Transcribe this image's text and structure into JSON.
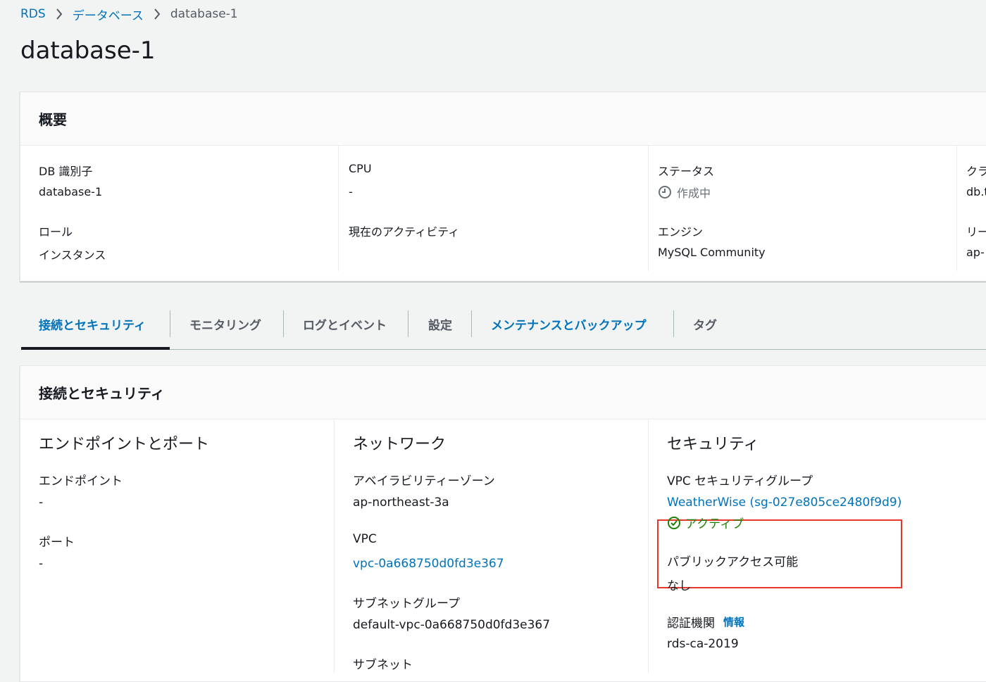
{
  "breadcrumb": {
    "items": [
      "RDS",
      "データベース",
      "database-1"
    ]
  },
  "page_title": "database-1",
  "summary": {
    "header": "概要",
    "col1": {
      "db_id_label": "DB 識別子",
      "db_id_value": "database-1",
      "role_label": "ロール",
      "role_value": "インスタンス"
    },
    "col2": {
      "cpu_label": "CPU",
      "cpu_value": "-",
      "activity_label": "現在のアクティビティ"
    },
    "col3": {
      "status_label": "ステータス",
      "status_value": "作成中",
      "engine_label": "エンジン",
      "engine_value": "MySQL Community"
    },
    "col4": {
      "class_label": "クラ",
      "class_value": "db.t",
      "region_label": "リー",
      "region_value": "ap-"
    }
  },
  "tabs": [
    {
      "label": "接続とセキュリティ"
    },
    {
      "label": "モニタリング"
    },
    {
      "label": "ログとイベント"
    },
    {
      "label": "設定"
    },
    {
      "label": "メンテナンスとバックアップ"
    },
    {
      "label": "タグ"
    }
  ],
  "connectivity": {
    "header": "接続とセキュリティ",
    "endpoint_section": {
      "title": "エンドポイントとポート",
      "endpoint_label": "エンドポイント",
      "endpoint_value": "-",
      "port_label": "ポート",
      "port_value": "-"
    },
    "network_section": {
      "title": "ネットワーク",
      "az_label": "アベイラビリティーゾーン",
      "az_value": "ap-northeast-3a",
      "vpc_label": "VPC",
      "vpc_value": "vpc-0a668750d0fd3e367",
      "subnet_group_label": "サブネットグループ",
      "subnet_group_value": "default-vpc-0a668750d0fd3e367",
      "subnet_label": "サブネット"
    },
    "security_section": {
      "title": "セキュリティ",
      "sg_label": "VPC セキュリティグループ",
      "sg_value": "WeatherWise (sg-027e805ce2480f9d9)",
      "sg_status": "アクティブ",
      "public_label": "パブリックアクセス可能",
      "public_value": "なし",
      "ca_label": "認証機関",
      "ca_info": "情報",
      "ca_value": "rds-ca-2019"
    }
  },
  "colors": {
    "link": "#0073bb",
    "active_green": "#1d8102",
    "highlight_red": "#e8362a"
  }
}
